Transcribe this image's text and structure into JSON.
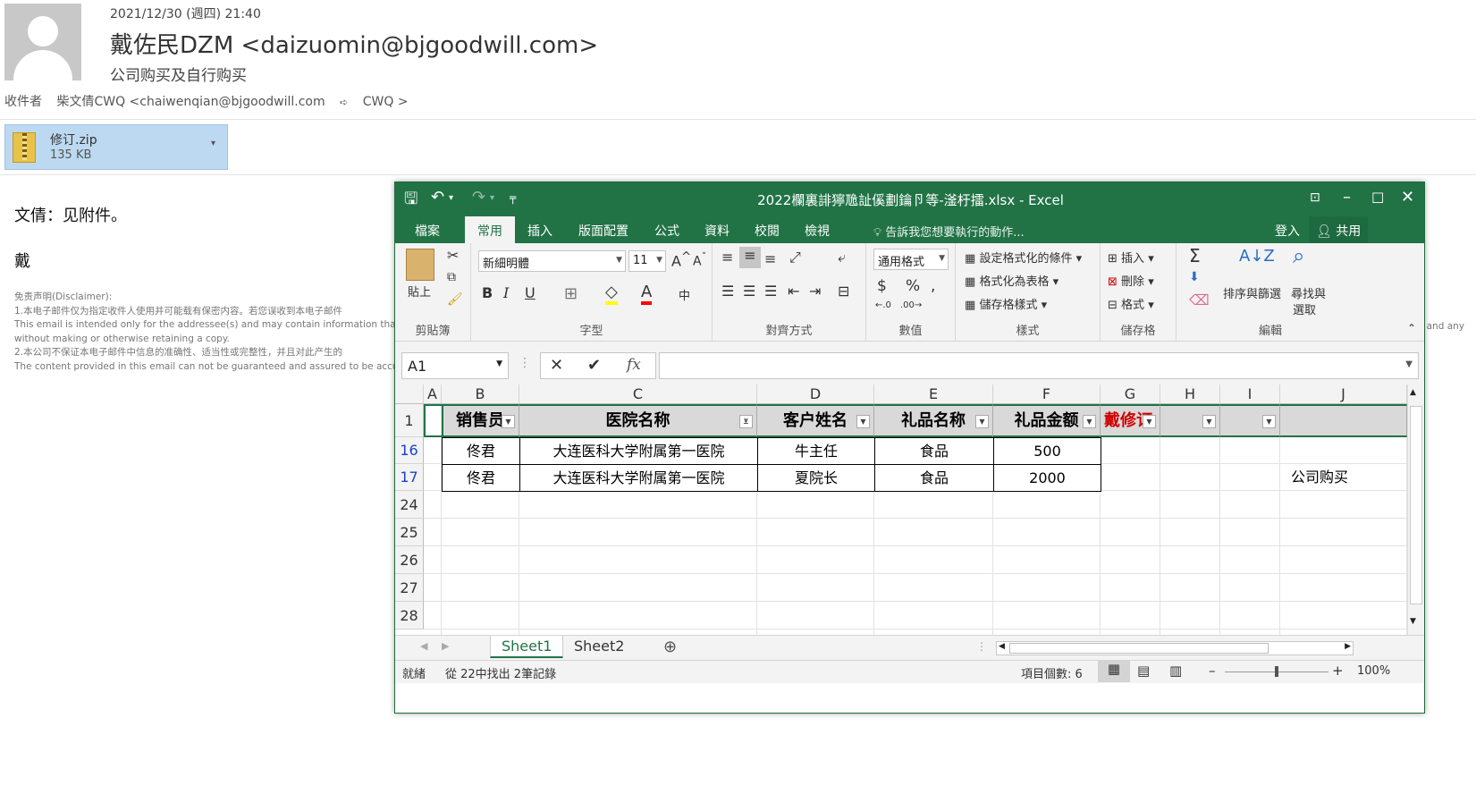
{
  "email": {
    "date": "2021/12/30 (週四) 21:40",
    "from": "戴佐民DZM <daizuomin@bjgoodwill.com>",
    "subject": "公司购买及自行购买",
    "to_label": "收件者",
    "to_value": "柴文倩CWQ <chaiwenqian@bjgoodwill.com",
    "cc_icon": "cc-icon",
    "cc_value": "CWQ >",
    "attachment": {
      "name": "修订.zip",
      "size": "135 KB"
    },
    "body_line1": "文倩：见附件。",
    "body_line2": "戴",
    "disclaimer": [
      "免责声明(Disclaimer):",
      "1.本电子邮件仅为指定收件人使用并可能载有保密内容。若您误收到本电子邮件",
      "This email is intended only for the addressee(s) and may contain information that is",
      "without making or otherwise retaining a copy.",
      "2.本公司不保证本电子邮件中信息的准确性、适当性或完整性，并且对此产生的",
      "The content provided in this email can not be guaranteed and assured to be accurate"
    ],
    "disclaimer_right": "ail and any"
  },
  "excel": {
    "title": "2022欄裏誹獰卼訨傒劃鑰卪等-滏杅擂.xlsx - Excel",
    "tabs": [
      "檔案",
      "常用",
      "插入",
      "版面配置",
      "公式",
      "資料",
      "校閱",
      "檢視"
    ],
    "active_tab": "常用",
    "tell_me": "告訴我您想要執行的動作...",
    "signin": "登入",
    "share": "共用",
    "ribbon": {
      "clipboard": "剪貼簿",
      "paste": "貼上",
      "font_group": "字型",
      "font_name": "新細明體",
      "font_size": "11",
      "bold": "B",
      "italic": "I",
      "underline": "U",
      "align_group": "對齊方式",
      "number_group": "數值",
      "number_format": "通用格式",
      "currency": "$",
      "percent": "%",
      "comma": ",",
      "styles_group": "樣式",
      "cond_format": "設定格式化的條件",
      "format_table": "格式化為表格",
      "cell_styles": "儲存格樣式",
      "cells_group": "儲存格",
      "insert": "插入",
      "delete": "刪除",
      "format": "格式",
      "editing_group": "編輯",
      "sort_filter": "排序與篩選",
      "find_select_1": "尋找與",
      "find_select_2": "選取"
    },
    "name_box": "A1",
    "fx": "fx",
    "columns": [
      "A",
      "B",
      "C",
      "D",
      "E",
      "F",
      "G",
      "H",
      "I",
      "J"
    ],
    "header_row": {
      "row": "1",
      "cells": [
        "销售员",
        "医院名称",
        "客户姓名",
        "礼品名称",
        "礼品金额",
        "戴修订"
      ]
    },
    "rows": [
      {
        "row": "16",
        "cells": [
          "佟君",
          "大连医科大学附属第一医院",
          "牛主任",
          "食品",
          "500",
          "",
          ""
        ]
      },
      {
        "row": "17",
        "cells": [
          "佟君",
          "大连医科大学附属第一医院",
          "夏院长",
          "食品",
          "2000",
          "",
          "公司购买"
        ]
      }
    ],
    "empty_rows": [
      "24",
      "25",
      "26",
      "27",
      "28"
    ],
    "sheets": [
      "Sheet1",
      "Sheet2"
    ],
    "active_sheet": "Sheet1",
    "status": {
      "ready": "就緒",
      "filter": "從 22中找出 2筆記錄",
      "count": "項目個數: 6",
      "zoom": "100%"
    }
  }
}
